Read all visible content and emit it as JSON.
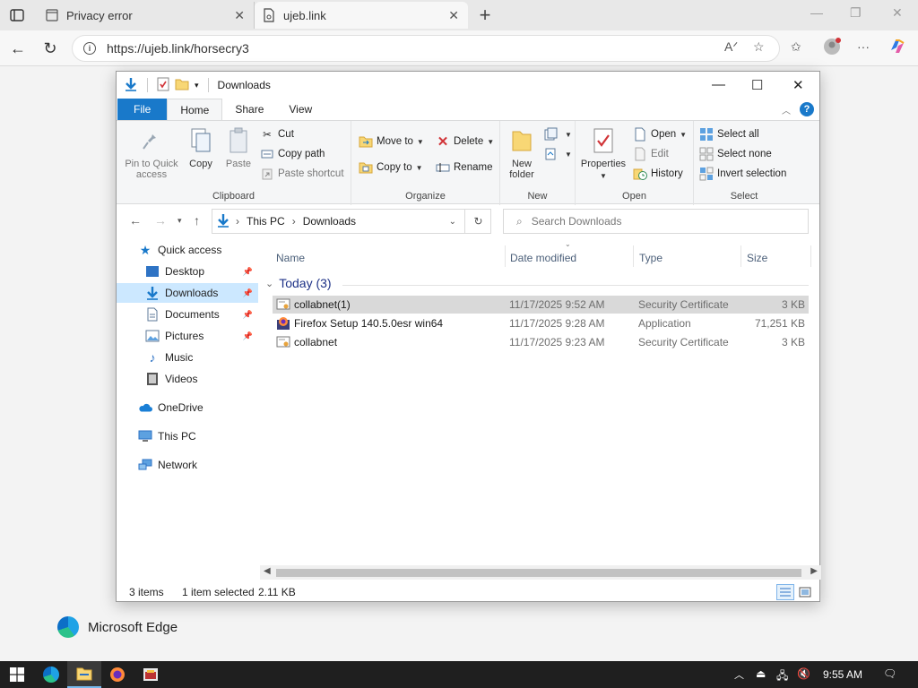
{
  "browser": {
    "tabs": [
      {
        "label": "Privacy error"
      },
      {
        "label": "ujeb.link"
      }
    ],
    "url": "https://ujeb.link/horsecry3"
  },
  "explorer": {
    "title": "Downloads",
    "ribbon_tabs": [
      "File",
      "Home",
      "Share",
      "View"
    ],
    "clipboard": {
      "pin": "Pin to Quick access",
      "copy": "Copy",
      "paste": "Paste",
      "cut": "Cut",
      "copy_path": "Copy path",
      "paste_shortcut": "Paste shortcut",
      "label": "Clipboard"
    },
    "organize": {
      "move_to": "Move to",
      "copy_to": "Copy to",
      "delete": "Delete",
      "rename": "Rename",
      "label": "Organize"
    },
    "new": {
      "new_folder": "New folder",
      "label": "New"
    },
    "open": {
      "properties": "Properties",
      "open": "Open",
      "edit": "Edit",
      "history": "History",
      "label": "Open"
    },
    "select": {
      "select_all": "Select all",
      "select_none": "Select none",
      "invert": "Invert selection",
      "label": "Select"
    },
    "breadcrumb": [
      "This PC",
      "Downloads"
    ],
    "search_placeholder": "Search Downloads",
    "nav": [
      {
        "label": "Quick access",
        "icon": "star-icon"
      },
      {
        "label": "Desktop",
        "icon": "desktop-icon",
        "pinned": true
      },
      {
        "label": "Downloads",
        "icon": "download-icon",
        "pinned": true,
        "selected": true
      },
      {
        "label": "Documents",
        "icon": "documents-icon",
        "pinned": true
      },
      {
        "label": "Pictures",
        "icon": "pictures-icon",
        "pinned": true
      },
      {
        "label": "Music",
        "icon": "music-icon"
      },
      {
        "label": "Videos",
        "icon": "videos-icon"
      },
      {
        "label": "OneDrive",
        "icon": "cloud-icon"
      },
      {
        "label": "This PC",
        "icon": "computer-icon"
      },
      {
        "label": "Network",
        "icon": "network-icon"
      }
    ],
    "columns": [
      "Name",
      "Date modified",
      "Type",
      "Size"
    ],
    "group_header": "Today (3)",
    "files": [
      {
        "name": "collabnet(1)",
        "date": "11/17/2025 9:52 AM",
        "type": "Security Certificate",
        "size": "3 KB",
        "icon": "certificate-icon",
        "selected": true
      },
      {
        "name": "Firefox Setup 140.5.0esr win64",
        "date": "11/17/2025 9:28 AM",
        "type": "Application",
        "size": "71,251 KB",
        "icon": "installer-icon"
      },
      {
        "name": "collabnet",
        "date": "11/17/2025 9:23 AM",
        "type": "Security Certificate",
        "size": "3 KB",
        "icon": "certificate-icon"
      }
    ],
    "status": {
      "items": "3 items",
      "selected": "1 item selected",
      "size": "2.11 KB"
    }
  },
  "edge_brand": "Microsoft Edge",
  "taskbar": {
    "clock": "9:55 AM"
  },
  "colors": {
    "accent": "#1979ca",
    "selection": "#cce8ff",
    "taskbar": "#1f1f1f"
  }
}
